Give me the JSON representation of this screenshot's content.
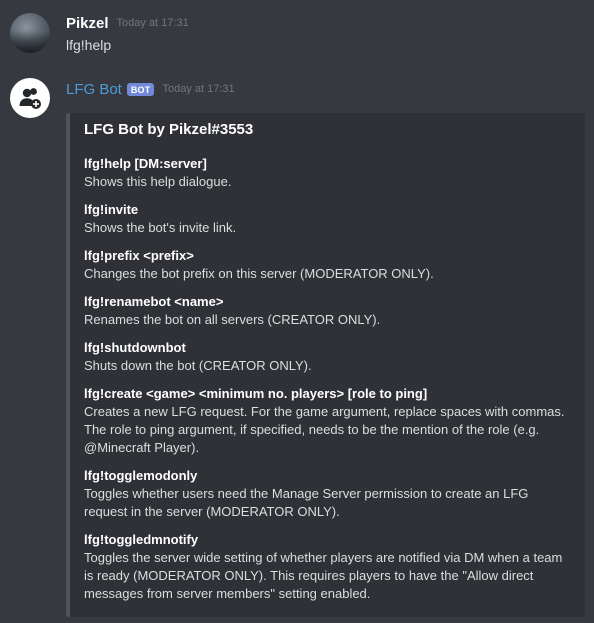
{
  "messages": {
    "user": {
      "username": "Pikzel",
      "timestamp": "Today at 17:31",
      "content": "lfg!help"
    },
    "bot": {
      "username": "LFG Bot",
      "tag": "BOT",
      "timestamp": "Today at 17:31",
      "embed": {
        "title": "LFG Bot by Pikzel#3553",
        "fields": [
          {
            "name": "lfg!help [DM:server]",
            "value": "Shows this help dialogue."
          },
          {
            "name": "lfg!invite",
            "value": "Shows the bot's invite link."
          },
          {
            "name": "lfg!prefix <prefix>",
            "value": "Changes the bot prefix on this server (MODERATOR ONLY)."
          },
          {
            "name": "lfg!renamebot <name>",
            "value": "Renames the bot on all servers (CREATOR ONLY)."
          },
          {
            "name": "lfg!shutdownbot",
            "value": "Shuts down the bot (CREATOR ONLY)."
          },
          {
            "name": "lfg!create <game> <minimum no. players> [role to ping]",
            "value": "Creates a new LFG request. For the game argument, replace spaces with commas. The role to ping argument, if specified, needs to be the mention of the role (e.g. @Minecraft Player)."
          },
          {
            "name": "lfg!togglemodonly",
            "value": "Toggles whether users need the Manage Server permission to create an LFG request in the server (MODERATOR ONLY)."
          },
          {
            "name": "lfg!toggledmnotify",
            "value": "Toggles the server wide setting of whether players are notified via DM when a team is ready (MODERATOR ONLY). This requires players to have the \"Allow direct messages from server members\" setting enabled."
          }
        ]
      }
    }
  },
  "colors": {
    "background": "#36393f",
    "embed_background": "#2f3136",
    "embed_border": "#4f545c",
    "bot_name": "#4d9cd8",
    "bot_tag": "#7289da",
    "timestamp": "#72767d"
  },
  "icons": {
    "user_avatar": "avatar-image",
    "bot_avatar": "add-user-icon"
  }
}
